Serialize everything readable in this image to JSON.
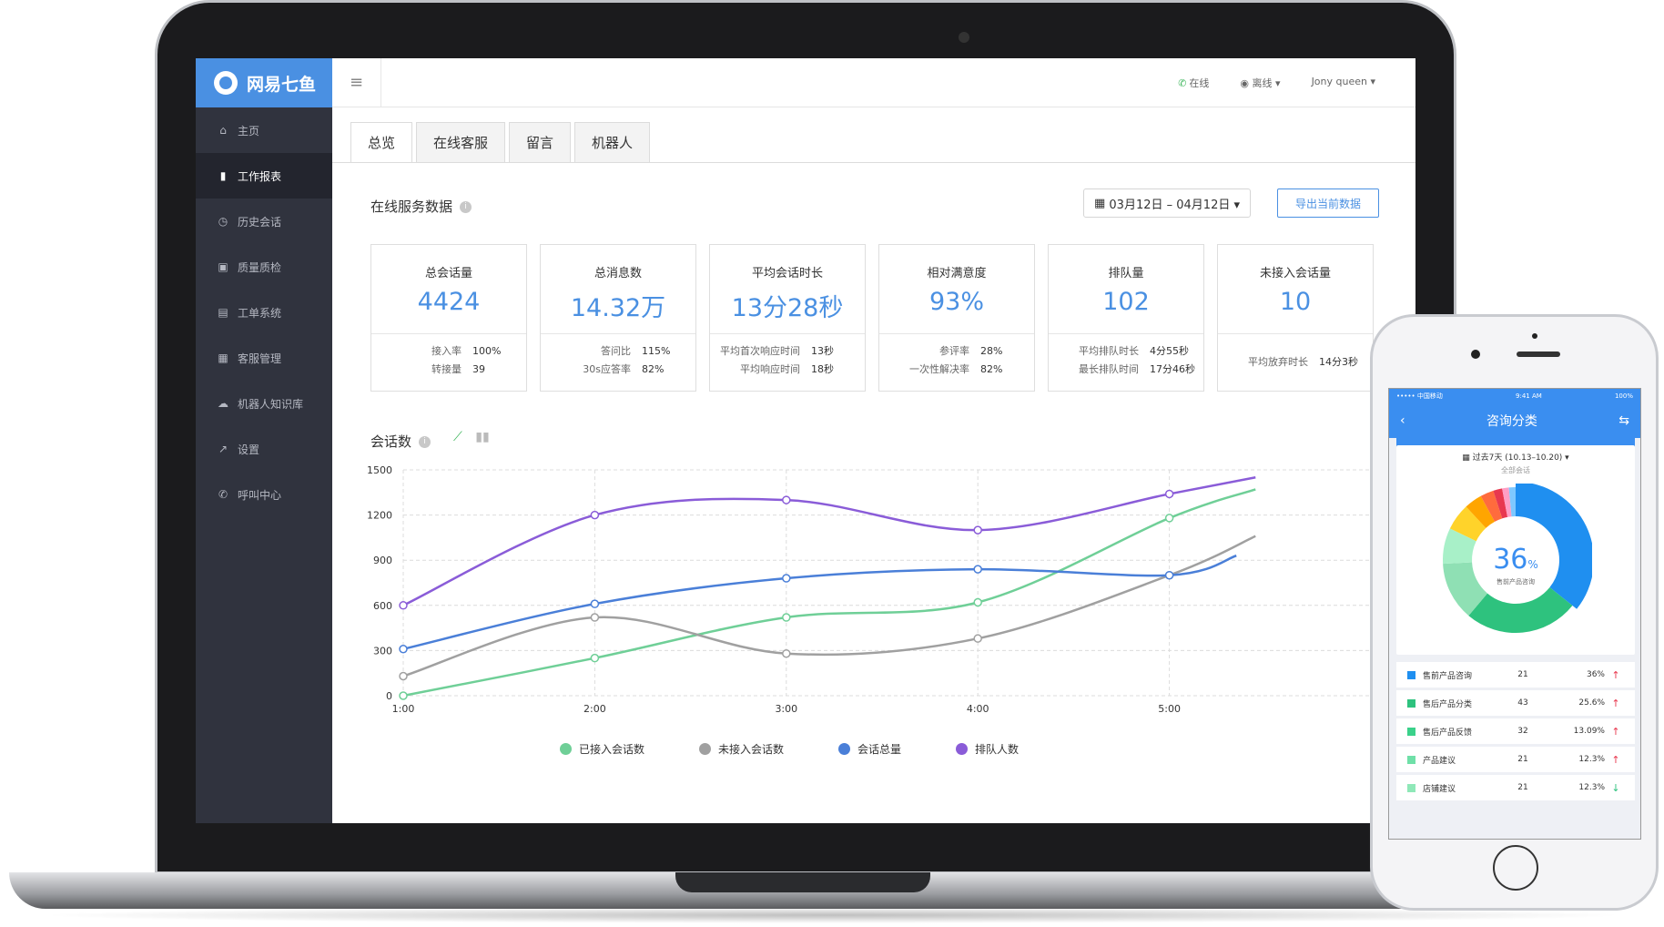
{
  "app": {
    "logo_text": "网易七鱼"
  },
  "sidebar": {
    "items": [
      {
        "label": "主页",
        "icon": "home-icon"
      },
      {
        "label": "工作报表",
        "icon": "bar-chart-icon"
      },
      {
        "label": "历史会话",
        "icon": "clock-icon"
      },
      {
        "label": "质量质检",
        "icon": "briefcase-icon"
      },
      {
        "label": "工单系统",
        "icon": "document-icon"
      },
      {
        "label": "客服管理",
        "icon": "grid-icon"
      },
      {
        "label": "机器人知识库",
        "icon": "cloud-icon"
      },
      {
        "label": "设置",
        "icon": "wrench-icon"
      },
      {
        "label": "呼叫中心",
        "icon": "phone-icon"
      }
    ]
  },
  "topbar": {
    "status_online": "在线",
    "status_offline": "离线 ▾",
    "user": "Jony queen ▾"
  },
  "tabs": [
    "总览",
    "在线客服",
    "留言",
    "机器人"
  ],
  "overview": {
    "title": "在线服务数据",
    "date_range": "03月12日 – 04月12日 ▾",
    "export_label": "导出当前数据",
    "cards": [
      {
        "title": "总会话量",
        "value": "4424",
        "rows": [
          {
            "label": "接入率",
            "value": "100%"
          },
          {
            "label": "转接量",
            "value": "39"
          }
        ]
      },
      {
        "title": "总消息数",
        "value": "14.32万",
        "rows": [
          {
            "label": "答问比",
            "value": "115%"
          },
          {
            "label": "30s应答率",
            "value": "82%"
          }
        ]
      },
      {
        "title": "平均会话时长",
        "value": "13分28秒",
        "rows": [
          {
            "label": "平均首次响应时间",
            "value": "13秒"
          },
          {
            "label": "平均响应时间",
            "value": "18秒"
          }
        ]
      },
      {
        "title": "相对满意度",
        "value": "93%",
        "rows": [
          {
            "label": "参评率",
            "value": "28%"
          },
          {
            "label": "一次性解决率",
            "value": "82%"
          }
        ]
      },
      {
        "title": "排队量",
        "value": "102",
        "rows": [
          {
            "label": "平均排队时长",
            "value": "4分55秒"
          },
          {
            "label": "最长排队时间",
            "value": "17分46秒"
          }
        ]
      },
      {
        "title": "未接入会话量",
        "value": "10",
        "rows": [
          {
            "label": "平均放弃时长",
            "value": "14分3秒"
          }
        ]
      }
    ]
  },
  "chart_title": "会话数",
  "chart_data": {
    "type": "line",
    "x": [
      "1:00",
      "2:00",
      "3:00",
      "4:00",
      "5:00"
    ],
    "x_numeric": [
      1,
      2,
      3,
      4,
      5
    ],
    "ylim": [
      0,
      1500
    ],
    "yticks": [
      "0",
      "300",
      "600",
      "900",
      "1200",
      "1500"
    ],
    "grid": true,
    "legend_position": "bottom",
    "series": [
      {
        "name": "已接入会话数",
        "color": "#6fcf97",
        "x": [
          1,
          2,
          3,
          4,
          5,
          5.45
        ],
        "values": [
          0,
          250,
          520,
          620,
          1180,
          1370
        ]
      },
      {
        "name": "未接入会话数",
        "color": "#a0a0a0",
        "x": [
          1,
          2,
          3,
          4,
          5,
          5.45
        ],
        "values": [
          130,
          520,
          280,
          380,
          800,
          1060
        ]
      },
      {
        "name": "会话总量",
        "color": "#4a7fd8",
        "x": [
          1,
          2,
          3,
          4,
          5,
          5.35
        ],
        "values": [
          310,
          610,
          780,
          840,
          800,
          930
        ]
      },
      {
        "name": "排队人数",
        "color": "#8a5cd8",
        "x": [
          1,
          2,
          3,
          4,
          5,
          5.45
        ],
        "values": [
          600,
          1200,
          1300,
          1100,
          1340,
          1450
        ]
      }
    ]
  },
  "phone": {
    "status_left": "••••• 中国移动",
    "time": "9:41 AM",
    "battery": "100%",
    "title": "咨询分类",
    "range": "过去7天 (10.13–10.20) ▾",
    "subtitle": "全部会话",
    "center_value": "36",
    "center_unit": "%",
    "center_label": "售前产品咨询",
    "donut": [
      {
        "color": "#1f8ff0",
        "value": 36
      },
      {
        "color": "#2ec27e",
        "value": 25.6
      },
      {
        "color": "#8fe0b4",
        "value": 13.09
      },
      {
        "color": "#a8f0c8",
        "value": 8
      },
      {
        "color": "#ffd32a",
        "value": 6
      },
      {
        "color": "#ffa500",
        "value": 4
      },
      {
        "color": "#ff6b3d",
        "value": 3
      },
      {
        "color": "#e8384f",
        "value": 2
      },
      {
        "color": "#ff9ec4",
        "value": 1.5
      },
      {
        "color": "#7ec8ff",
        "value": 1.5
      }
    ],
    "rows": [
      {
        "color": "#1f8ff0",
        "name": "售前产品咨询",
        "count": "21",
        "pct": "36%",
        "arrow": "↑",
        "arrow_color": "#e8384f"
      },
      {
        "color": "#2ec27e",
        "name": "售后产品分类",
        "count": "43",
        "pct": "25.6%",
        "arrow": "↑",
        "arrow_color": "#e8384f"
      },
      {
        "color": "#3ad18a",
        "name": "售后产品反馈",
        "count": "32",
        "pct": "13.09%",
        "arrow": "↑",
        "arrow_color": "#e8384f"
      },
      {
        "color": "#6fe0a8",
        "name": "产品建议",
        "count": "21",
        "pct": "12.3%",
        "arrow": "↑",
        "arrow_color": "#e8384f"
      },
      {
        "color": "#8fe8b8",
        "name": "店铺建议",
        "count": "21",
        "pct": "12.3%",
        "arrow": "↓",
        "arrow_color": "#2ec27e"
      }
    ]
  }
}
